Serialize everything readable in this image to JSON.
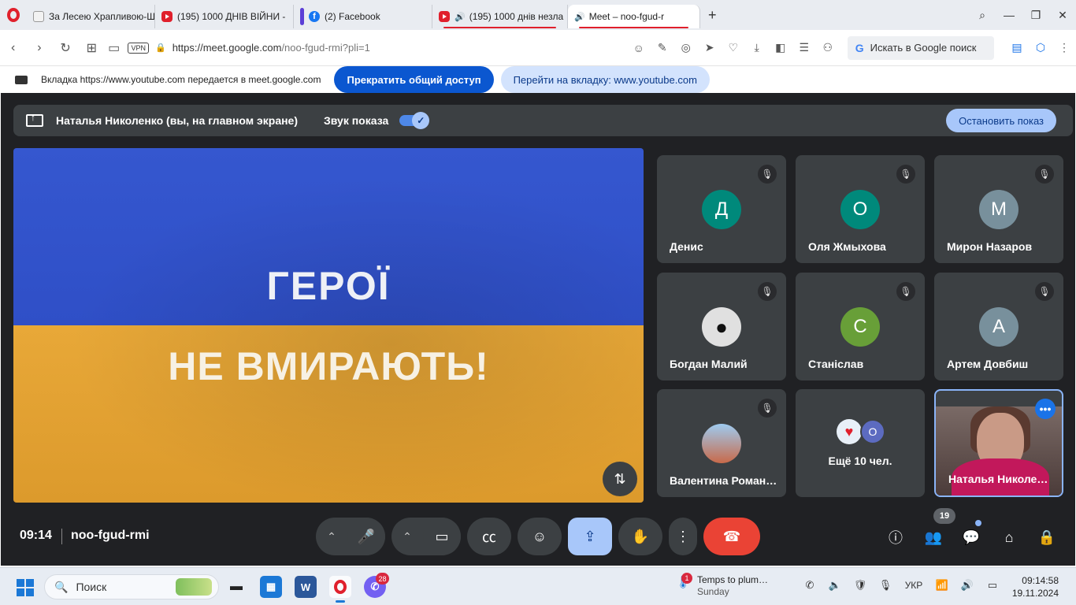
{
  "browser": {
    "tabs": [
      {
        "title": "За Лесею Храпливою-Щ",
        "icon": "document-icon",
        "audio": false
      },
      {
        "title": "(195) 1000 ДНІВ ВІЙНИ -",
        "icon": "youtube-icon",
        "audio": false
      },
      {
        "title": "(2) Facebook",
        "icon": "facebook-icon",
        "audio": false
      },
      {
        "title": "(195) 1000 днів незла",
        "icon": "youtube-icon",
        "audio": true
      },
      {
        "title": "Meet – noo-fgud-r",
        "icon": "meet-icon",
        "audio": true,
        "active": true
      }
    ],
    "new_tab": "+",
    "url_host": "https://meet.google.com",
    "url_path": "/noo-fgud-rmi?pli=1",
    "vpn_label": "VPN",
    "search_label": "Искать в Google поиск"
  },
  "share_banner": {
    "text": "Вкладка https://www.youtube.com передается в meet.google.com",
    "stop_label": "Прекратить общий доступ",
    "goto_label": "Перейти на вкладку: www.youtube.com"
  },
  "meet": {
    "presenting_text": "Наталья Николенко (вы, на главном экране)",
    "sound_label": "Звук показа",
    "sound_on": true,
    "stop_show_label": "Остановить показ",
    "stage": {
      "line1": "ГЕРОЇ",
      "line2": "НЕ ВМИРАЮТЬ!",
      "colors": {
        "top": "#3557cf",
        "bottom": "#e8a838"
      }
    },
    "participants": [
      {
        "name": "Денис",
        "initial": "Д",
        "color": "#00897b",
        "muted": true
      },
      {
        "name": "Оля Жмыхова",
        "initial": "О",
        "color": "#00897b",
        "muted": true
      },
      {
        "name": "Мирон Назаров",
        "initial": "М",
        "color": "#78909c",
        "muted": true
      },
      {
        "name": "Богдан Малий",
        "initial": "",
        "color": "#e0e0e0",
        "muted": true
      },
      {
        "name": "Станіслав",
        "initial": "С",
        "color": "#689f38",
        "muted": true
      },
      {
        "name": "Артем Довбиш",
        "initial": "А",
        "color": "#78909c",
        "muted": true
      },
      {
        "name": "Валентина Роман…",
        "initial": "",
        "color": "#90caf9",
        "muted": true
      }
    ],
    "more_label": "Ещё 10 чел.",
    "more_initial": "О",
    "self_name": "Наталья Николен…",
    "time": "09:14",
    "meeting_code": "noo-fgud-rmi",
    "participant_count": "19"
  },
  "taskbar": {
    "search_placeholder": "Поиск",
    "viber_badge": "28",
    "weather_title": "Temps to plum…",
    "weather_sub": "Sunday",
    "weather_badge": "1",
    "lang": "УКР",
    "time": "09:14:58",
    "date": "19.11.2024"
  }
}
